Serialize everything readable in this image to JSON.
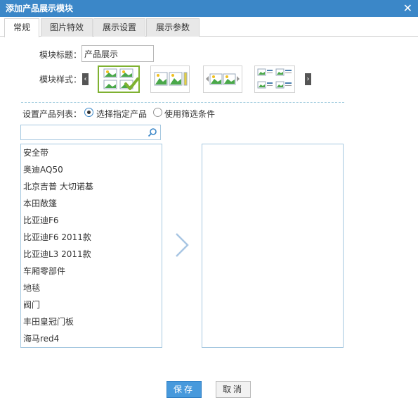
{
  "dialog": {
    "title": "添加产品展示模块",
    "close_icon": "close-icon"
  },
  "tabs": [
    {
      "label": "常规",
      "active": true
    },
    {
      "label": "图片特效",
      "active": false
    },
    {
      "label": "展示设置",
      "active": false
    },
    {
      "label": "展示参数",
      "active": false
    }
  ],
  "form": {
    "title_label": "模块标题：",
    "title_value": "产品展示",
    "style_label": "模块样式：",
    "styles": [
      {
        "icon": "grid-2x2-images-icon",
        "selected": true
      },
      {
        "icon": "row-images-icon",
        "selected": false
      },
      {
        "icon": "carousel-images-icon",
        "selected": false
      },
      {
        "icon": "images-with-text-list-icon",
        "selected": false
      }
    ],
    "product_list_label": "设置产品列表：",
    "radio_specific": "选择指定产品",
    "radio_filter": "使用筛选条件"
  },
  "product_list": [
    "安全带",
    "奥迪AQ50",
    "北京吉普 大切诺基",
    "本田敞篷",
    "比亚迪F6",
    "比亚迪F6 2011款",
    "比亚迪L3 2011款",
    "车厢零部件",
    "地毯",
    "阀门",
    "丰田皇冠门板",
    "海马red4"
  ],
  "buttons": {
    "save": "保存",
    "cancel": "取消"
  },
  "colors": {
    "titlebar": "#3b87c8",
    "primary_button": "#4799dc",
    "selected_style": "#7fb131",
    "list_border": "#a6c8e0"
  }
}
